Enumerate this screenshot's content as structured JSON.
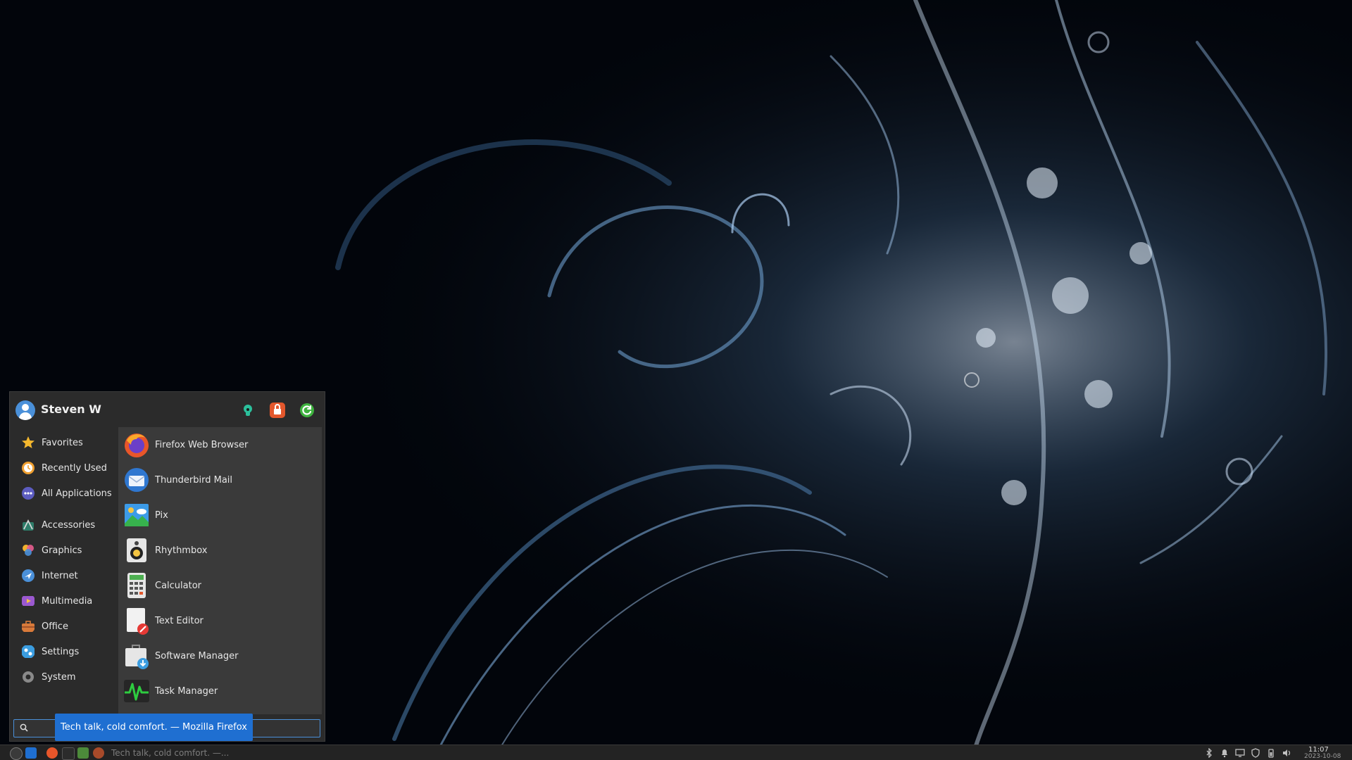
{
  "menu": {
    "user": {
      "name": "Steven W"
    },
    "header_actions": [
      {
        "icon": "lock-screen-icon",
        "color": "#2bbf9b"
      },
      {
        "icon": "logout-icon",
        "color": "#e3572c"
      },
      {
        "icon": "shutdown-icon",
        "color": "#3fb33f"
      }
    ],
    "categories": [
      {
        "label": "Favorites",
        "icon": "star-icon",
        "color": "#f5b82e"
      },
      {
        "label": "Recently Used",
        "icon": "clock-icon",
        "color": "#f0a030"
      },
      {
        "label": "All Applications",
        "icon": "apps-grid-icon",
        "color": "#7b7bd6"
      },
      {
        "label": "Accessories",
        "icon": "accessories-icon",
        "color": "#44a07a"
      },
      {
        "label": "Graphics",
        "icon": "graphics-icon",
        "color": "#e85d8f"
      },
      {
        "label": "Internet",
        "icon": "internet-icon",
        "color": "#4a90d9"
      },
      {
        "label": "Multimedia",
        "icon": "multimedia-icon",
        "color": "#9b59d0"
      },
      {
        "label": "Office",
        "icon": "office-icon",
        "color": "#d97a3a"
      },
      {
        "label": "Settings",
        "icon": "settings-icon",
        "color": "#3b9de0"
      },
      {
        "label": "System",
        "icon": "system-icon",
        "color": "#b0b0b0"
      }
    ],
    "apps": [
      {
        "label": "Firefox Web Browser",
        "icon": "firefox-icon"
      },
      {
        "label": "Thunderbird Mail",
        "icon": "thunderbird-icon"
      },
      {
        "label": "Pix",
        "icon": "pix-icon"
      },
      {
        "label": "Rhythmbox",
        "icon": "rhythmbox-icon"
      },
      {
        "label": "Calculator",
        "icon": "calculator-icon"
      },
      {
        "label": "Text Editor",
        "icon": "text-editor-icon"
      },
      {
        "label": "Software Manager",
        "icon": "software-manager-icon"
      },
      {
        "label": "Task Manager",
        "icon": "task-manager-icon"
      }
    ],
    "search": {
      "value": "",
      "placeholder": ""
    }
  },
  "tooltip": {
    "text": "Tech talk, cold comfort. — Mozilla Firefox"
  },
  "taskbar": {
    "task_label": "Tech talk, cold comfort. —...",
    "tray": [
      "bluetooth-icon",
      "notifications-icon",
      "display-icon",
      "shield-icon",
      "battery-icon",
      "volume-icon"
    ],
    "clock": {
      "time": "11:07",
      "date": "2023-10-08"
    }
  }
}
